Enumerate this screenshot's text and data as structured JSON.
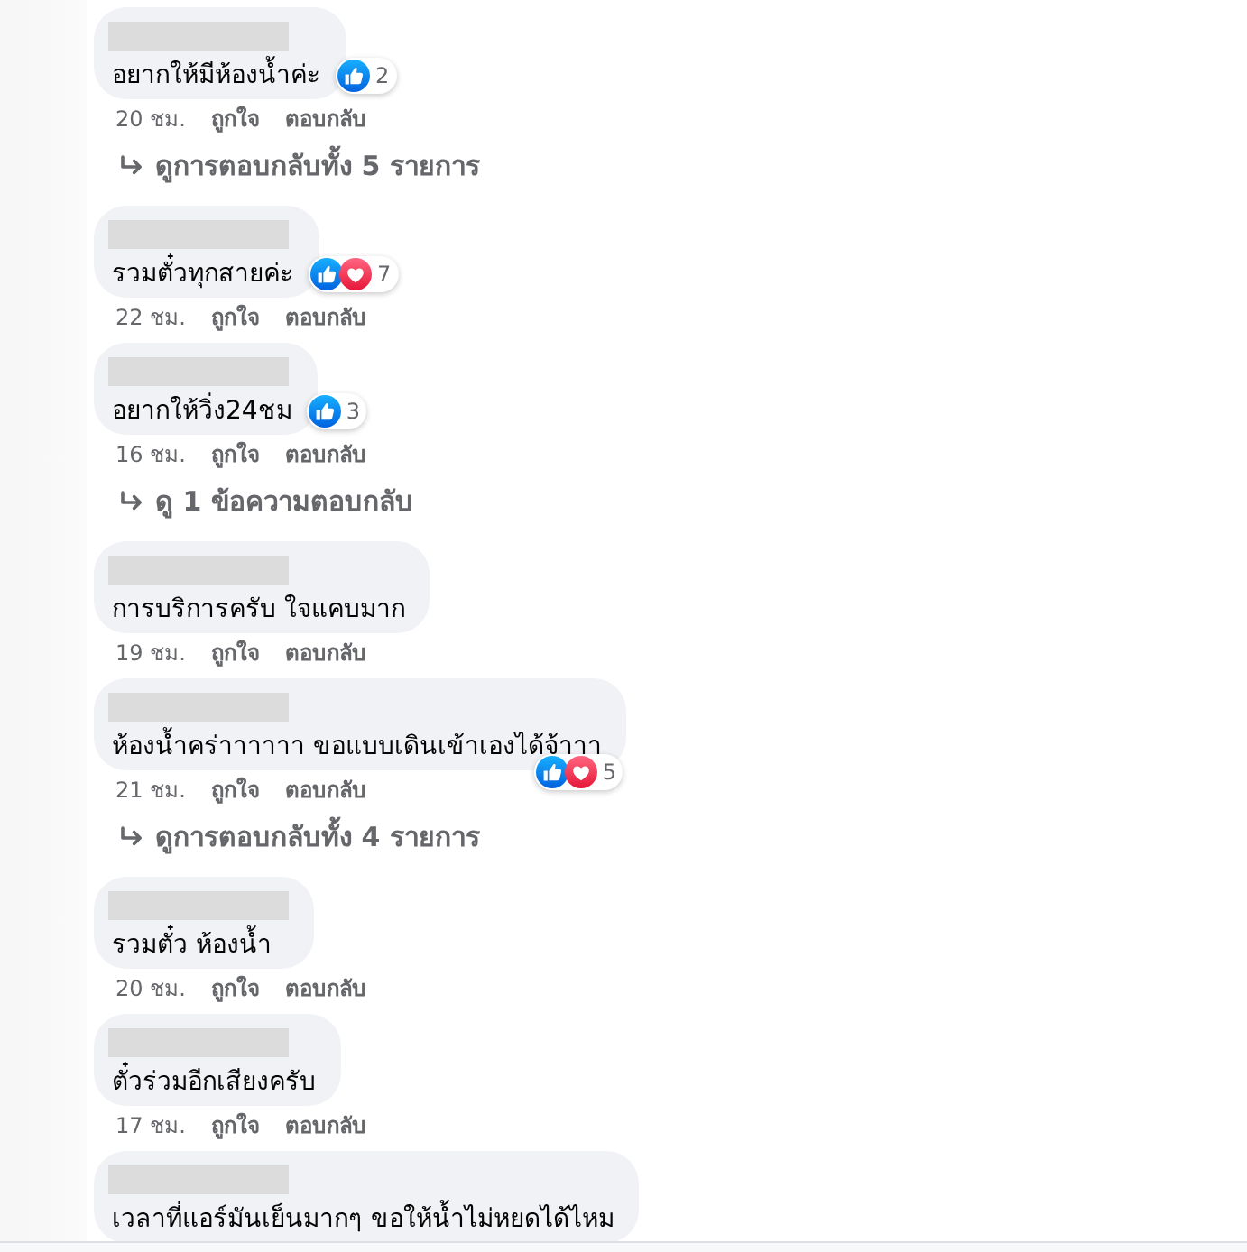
{
  "comments": [
    {
      "text": "อยากให้มีห้องน้ำค่ะ",
      "reactions": {
        "icons": [
          {
            "kind": "like"
          }
        ],
        "count": "2"
      },
      "time": "20 ชม.",
      "actions": [
        "ถูกใจ",
        "ตอบกลับ"
      ],
      "replies_link": "ดูการตอบกลับทั้ง 5 รายการ"
    },
    {
      "text": "รวมตั๋วทุกสายค่ะ",
      "reactions": {
        "icons": [
          {
            "kind": "like"
          },
          {
            "kind": "love"
          }
        ],
        "count": "7"
      },
      "time": "22 ชม.",
      "actions": [
        "ถูกใจ",
        "ตอบกลับ"
      ]
    },
    {
      "text": "อยากให้วิ่ง24ชม",
      "reactions": {
        "icons": [
          {
            "kind": "like"
          }
        ],
        "count": "3"
      },
      "time": "16 ชม.",
      "actions": [
        "ถูกใจ",
        "ตอบกลับ"
      ],
      "replies_link": "ดู 1 ข้อความตอบกลับ"
    },
    {
      "text": "การบริการครับ ใจแคบมาก",
      "time": "19 ชม.",
      "actions": [
        "ถูกใจ",
        "ตอบกลับ"
      ]
    },
    {
      "text": "ห้องน้ำคร่าาาาาา ขอแบบเดินเข้าเองได้จ้าาา",
      "reactions": {
        "icons": [
          {
            "kind": "like"
          },
          {
            "kind": "love"
          }
        ],
        "count": "5"
      },
      "time": "21 ชม.",
      "actions": [
        "ถูกใจ",
        "ตอบกลับ"
      ],
      "replies_link": "ดูการตอบกลับทั้ง 4 รายการ"
    },
    {
      "text": "รวมตั๋ว ห้องน้ำ",
      "time": "20 ชม.",
      "actions": [
        "ถูกใจ",
        "ตอบกลับ"
      ]
    },
    {
      "text": "ตั๋วร่วมอีกเสียงครับ",
      "time": "17 ชม.",
      "actions": [
        "ถูกใจ",
        "ตอบกลับ"
      ]
    },
    {
      "text": "เวลาที่แอร์มันเย็นมากๆ ขอให้น้ำไม่หยดได้ไหม"
    }
  ]
}
